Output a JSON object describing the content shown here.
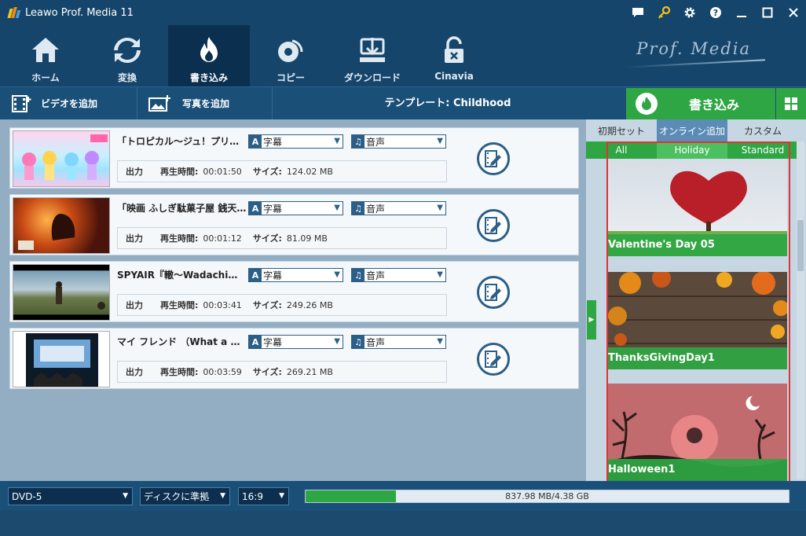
{
  "app": {
    "title": "Leawo Prof. Media 11"
  },
  "titlebar_icons": [
    "chat-icon",
    "key-icon",
    "gear-icon",
    "help-icon",
    "minimize-icon",
    "maximize-icon",
    "close-icon"
  ],
  "nav": {
    "items": [
      {
        "label": "ホーム",
        "icon": "home-icon"
      },
      {
        "label": "変換",
        "icon": "convert-icon"
      },
      {
        "label": "書き込み",
        "icon": "burn-flame-icon",
        "active": true
      },
      {
        "label": "コピー",
        "icon": "disc-copy-icon"
      },
      {
        "label": "ダウンロード",
        "icon": "download-icon"
      },
      {
        "label": "Cinavia",
        "icon": "lock-icon"
      }
    ],
    "brand": "Prof. Media"
  },
  "toolbar": {
    "add_video": "ビデオを追加",
    "add_photo": "写真を追加",
    "template": "テンプレート: Childhood",
    "burn": "書き込み"
  },
  "list": {
    "items": [
      {
        "title": "「トロピカル～ジュ！プリキュア…",
        "subtitle": "字幕",
        "audio": "音声",
        "output": "出力",
        "duration_label": "再生時間:",
        "duration": "00:01:50",
        "size_label": "サイズ:",
        "size": "124.02 MB"
      },
      {
        "title": "「映画 ふしぎ駄菓子屋 銭天…",
        "subtitle": "字幕",
        "audio": "音声",
        "output": "出力",
        "duration_label": "再生時間:",
        "duration": "00:01:12",
        "size_label": "サイズ:",
        "size": "81.09 MB"
      },
      {
        "title": "SPYAIR『轍～Wadachi…",
        "subtitle": "字幕",
        "audio": "音声",
        "output": "出力",
        "duration_label": "再生時間:",
        "duration": "00:03:41",
        "size_label": "サイズ:",
        "size": "249.26 MB"
      },
      {
        "title": "マイ フレンド （What a be…",
        "subtitle": "字幕",
        "audio": "音声",
        "output": "出力",
        "duration_label": "再生時間:",
        "duration": "00:03:59",
        "size_label": "サイズ:",
        "size": "269.21 MB"
      }
    ]
  },
  "right_panel": {
    "tabs": [
      {
        "label": "初期セット"
      },
      {
        "label": "オンライン追加",
        "active": true
      },
      {
        "label": "カスタム"
      }
    ],
    "subtabs": [
      {
        "label": "All"
      },
      {
        "label": "Holiday",
        "active": true
      },
      {
        "label": "Standard"
      }
    ],
    "templates": [
      {
        "name": "Valentine's Day 05"
      },
      {
        "name": "ThanksGivingDay1"
      },
      {
        "name": "Halloween1"
      }
    ]
  },
  "bottom": {
    "disc_type": "DVD-5",
    "quality": "ディスクに準拠",
    "aspect": "16:9",
    "progress_text": "837.98 MB/4.38 GB",
    "progress_fraction": 0.187
  },
  "colors": {
    "accent_green": "#2ea643",
    "dark_blue": "#15456a",
    "highlight_red": "#e03434"
  }
}
